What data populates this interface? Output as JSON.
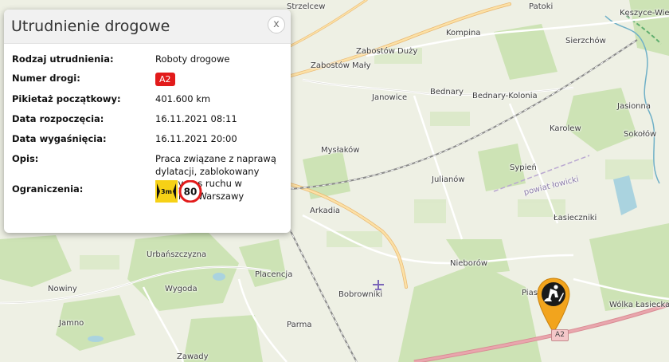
{
  "popup": {
    "title": "Utrudnienie drogowe",
    "close_label": "x",
    "rows": [
      {
        "label": "Rodzaj utrudnienia:",
        "value": "Roboty drogowe"
      },
      {
        "label": "Numer drogi:",
        "value": "A2"
      },
      {
        "label": "Pikietaż początkowy:",
        "value": "401.600 km"
      },
      {
        "label": "Data rozpoczęcia:",
        "value": "16.11.2021 08:11"
      },
      {
        "label": "Data wygaśnięcia:",
        "value": "16.11.2021 20:00"
      },
      {
        "label": "Opis:",
        "value": "Praca związane z naprawą dylatacji, zablokowany prawy pas ruchu w kierunku Warszawy"
      },
      {
        "label": "Ograniczenia:",
        "value": ""
      }
    ],
    "restrictions": {
      "width_limit": "3m",
      "speed_limit": "80"
    },
    "road_badge_color": "#e21b1b"
  },
  "map": {
    "places": [
      "Strzelcew",
      "Patoki",
      "Kęszyce-Wieś",
      "Kompina",
      "Zabostów Duży",
      "Sierzchów",
      "Zabostów Mały",
      "Janowice",
      "Bednary",
      "Bednary-Kolonia",
      "Jasionna",
      "Karolew",
      "Sokołów",
      "Mysłaków",
      "Julianów",
      "Sypień",
      "powiat łowicki",
      "Arkadia",
      "Łasieczniki",
      "Urbańszczyzna",
      "Nieborów",
      "Placencja",
      "Nowiny",
      "Wygoda",
      "Bobrowniki",
      "Pias",
      "Wólka Łasiecka",
      "Jamno",
      "Parma",
      "Zawady"
    ],
    "marker_road": "A2"
  }
}
